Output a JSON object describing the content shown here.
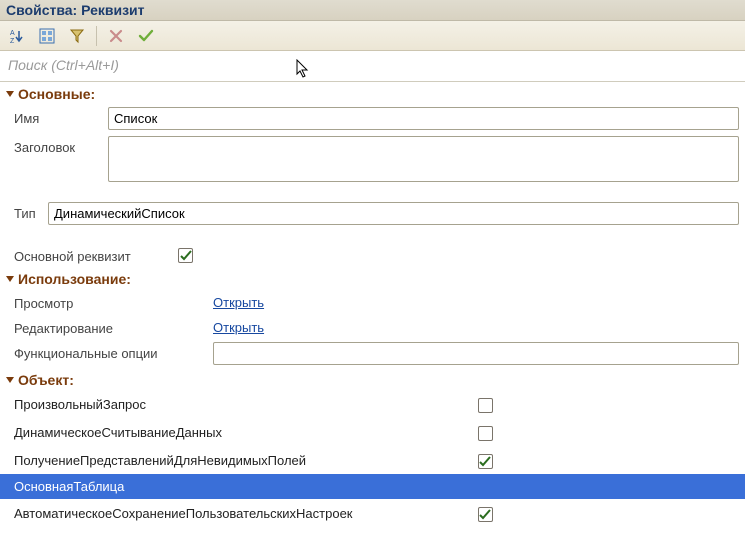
{
  "window_title": "Свойства: Реквизит",
  "search": {
    "placeholder": "Поиск (Ctrl+Alt+I)"
  },
  "sections": {
    "main": {
      "title": "Основные:",
      "name_label": "Имя",
      "name_value": "Список",
      "caption_label": "Заголовок",
      "caption_value": "",
      "type_label": "Тип",
      "type_value": "ДинамическийСписок",
      "main_attr_label": "Основной реквизит",
      "main_attr_checked": true
    },
    "usage": {
      "title": "Использование:",
      "view_label": "Просмотр",
      "view_link": "Открыть",
      "edit_label": "Редактирование",
      "edit_link": "Открыть",
      "funcopts_label": "Функциональные опции",
      "funcopts_value": ""
    },
    "object": {
      "title": "Объект:",
      "rows": [
        {
          "label": "ПроизвольныйЗапрос",
          "checked": false,
          "selected": false
        },
        {
          "label": "ДинамическоеСчитываниеДанных",
          "checked": false,
          "selected": false
        },
        {
          "label": "ПолучениеПредставленийДляНевидимыхПолей",
          "checked": true,
          "selected": false
        },
        {
          "label": "ОсновнаяТаблица",
          "checked": null,
          "selected": true
        },
        {
          "label": "АвтоматическоеСохранениеПользовательскихНастроек",
          "checked": true,
          "selected": false
        }
      ]
    }
  }
}
